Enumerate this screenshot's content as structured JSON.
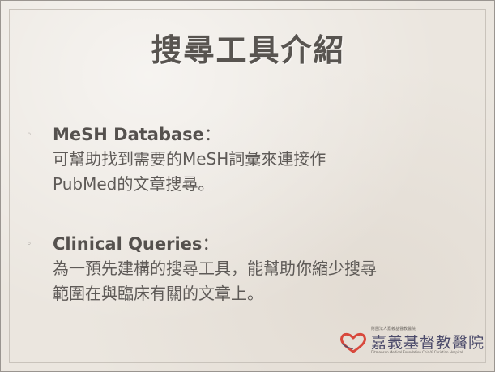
{
  "slide": {
    "title": "搜尋工具介紹",
    "bullets": [
      {
        "heading": "MeSH Database",
        "separator": "：",
        "lines": [
          "可幫助找到需要的MeSH詞彙來連接作",
          "PubMed的文章搜尋。"
        ]
      },
      {
        "heading": "Clinical Queries",
        "separator": "：",
        "lines": [
          "為一預先建構的搜尋工具，能幫助你縮少搜尋",
          "範圍在與臨床有關的文章上。"
        ]
      }
    ],
    "bullet_glyph": "◦",
    "logo": {
      "icon": "heart-logo-icon",
      "small_text": "財團法人嘉義基督教醫院",
      "name": "嘉義基督教醫院",
      "english": "Ditmanson Medical Foundation Chia-Yi Christian Hospital"
    }
  },
  "colors": {
    "background": "#ebe6df",
    "title": "#585450",
    "text": "#5a5653",
    "logo_red": "#d8483c",
    "logo_text": "#4b4a6a"
  }
}
